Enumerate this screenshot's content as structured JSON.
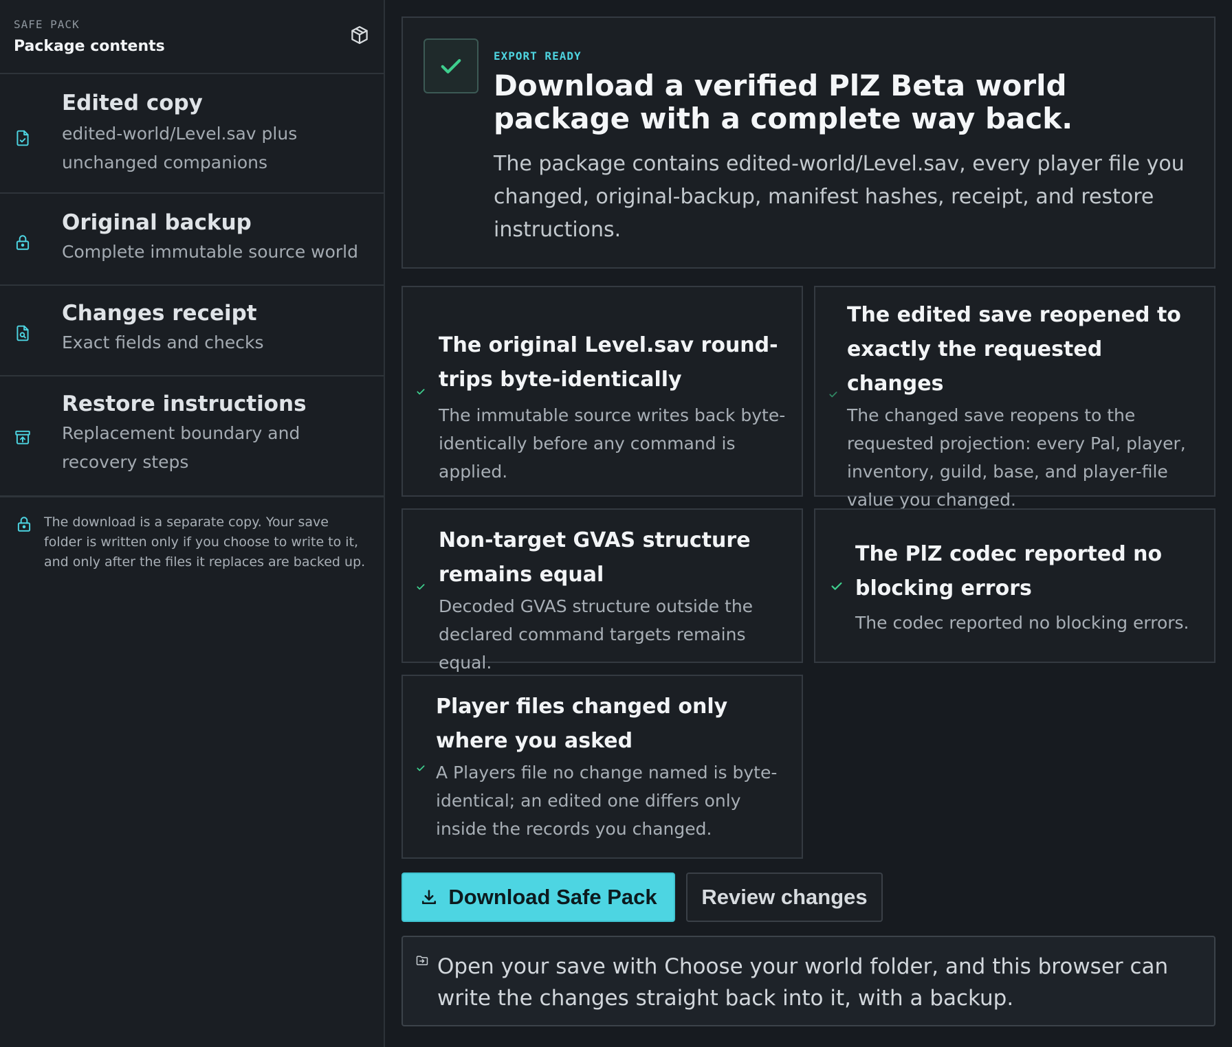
{
  "sidebar": {
    "eyebrow": "SAFE PACK",
    "title": "Package contents",
    "header_icon": "package-icon",
    "items": [
      {
        "title": "Edited copy",
        "desc": "edited-world/Level.sav plus unchanged companions",
        "icon": "file-check-icon"
      },
      {
        "title": "Original backup",
        "desc": "Complete immutable source world",
        "icon": "lock-icon"
      },
      {
        "title": "Changes receipt",
        "desc": "Exact fields and checks",
        "icon": "file-search-icon"
      },
      {
        "title": "Restore instructions",
        "desc": "Replacement boundary and recovery steps",
        "icon": "archive-restore-icon"
      }
    ],
    "note": "The download is a separate copy. Your save folder is written only if you choose to write to it, and only after the files it replaces are backed up."
  },
  "hero": {
    "eyebrow": "EXPORT READY",
    "title": "Download a verified PlZ Beta world package with a complete way back.",
    "body": "The package contains edited-world/Level.sav, every player file you changed, original-backup, manifest hashes, receipt, and restore instructions."
  },
  "checks": [
    {
      "title": "The original Level.sav round-trips byte-identically",
      "desc": "The immutable source writes back byte-identically before any command is applied."
    },
    {
      "title": "The edited save reopened to exactly the requested changes",
      "desc": "The changed save reopens to the requested projection: every Pal, player, inventory, guild, base, and player-file value you changed."
    },
    {
      "title": "Non-target GVAS structure remains equal",
      "desc": "Decoded GVAS structure outside the declared command targets remains equal."
    },
    {
      "title": "The PlZ codec reported no blocking errors",
      "desc": "The codec reported no blocking errors."
    },
    {
      "title": "Player files changed only where you asked",
      "desc": "A Players file no change named is byte-identical; an edited one differs only inside the records you changed."
    }
  ],
  "actions": {
    "download_label": "Download Safe Pack",
    "review_label": "Review changes"
  },
  "notice": {
    "text": "Open your save with Choose your world folder, and this browser can write the changes straight back into it, with a backup."
  },
  "colors": {
    "accent": "#4dd5e2",
    "success": "#3ecf8e",
    "background": "#171b20",
    "card_border": "#343a41"
  }
}
